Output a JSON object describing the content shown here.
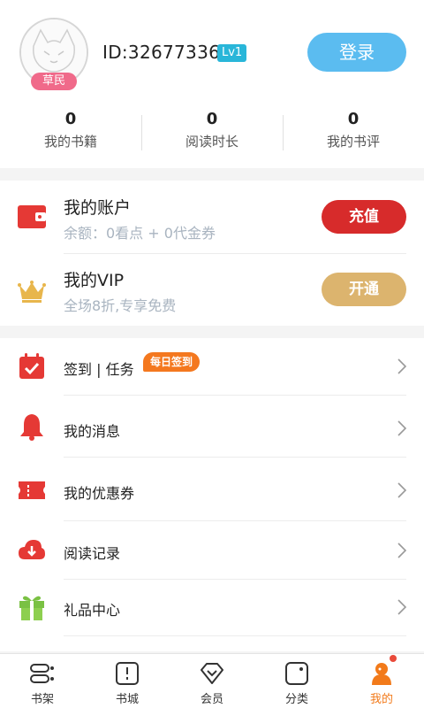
{
  "profile": {
    "id_text": "ID:326773366",
    "level": "Lv1",
    "rank": "草民",
    "login_label": "登录"
  },
  "stats": [
    {
      "value": "0",
      "label": "我的书籍"
    },
    {
      "value": "0",
      "label": "阅读时长"
    },
    {
      "value": "0",
      "label": "我的书评"
    }
  ],
  "account": {
    "title": "我的账户",
    "balance": "余额：0看点 + 0代金券",
    "recharge_label": "充值"
  },
  "vip": {
    "title": "我的VIP",
    "subtitle": "全场8折,专享免费",
    "open_label": "开通"
  },
  "menu": [
    {
      "label": "签到 | 任务",
      "icon": "calendar-check-icon"
    },
    {
      "label": "我的消息",
      "icon": "bell-icon"
    },
    {
      "label": "我的优惠券",
      "icon": "ticket-icon"
    },
    {
      "label": "阅读记录",
      "icon": "cloud-download-icon"
    },
    {
      "label": "礼品中心",
      "icon": "gift-icon"
    }
  ],
  "daily_badge": "每日签到",
  "tabs": [
    {
      "label": "书架",
      "icon": "bookshelf-icon"
    },
    {
      "label": "书城",
      "icon": "bookstore-icon"
    },
    {
      "label": "会员",
      "icon": "diamond-icon"
    },
    {
      "label": "分类",
      "icon": "category-icon"
    },
    {
      "label": "我的",
      "icon": "user-icon",
      "active": true
    }
  ],
  "colors": {
    "login": "#5bbcf0",
    "recharge": "#d72b2b",
    "vip_gold": "#dcb46e",
    "badge": "#f4781f",
    "active_tab": "#f27a1a"
  }
}
